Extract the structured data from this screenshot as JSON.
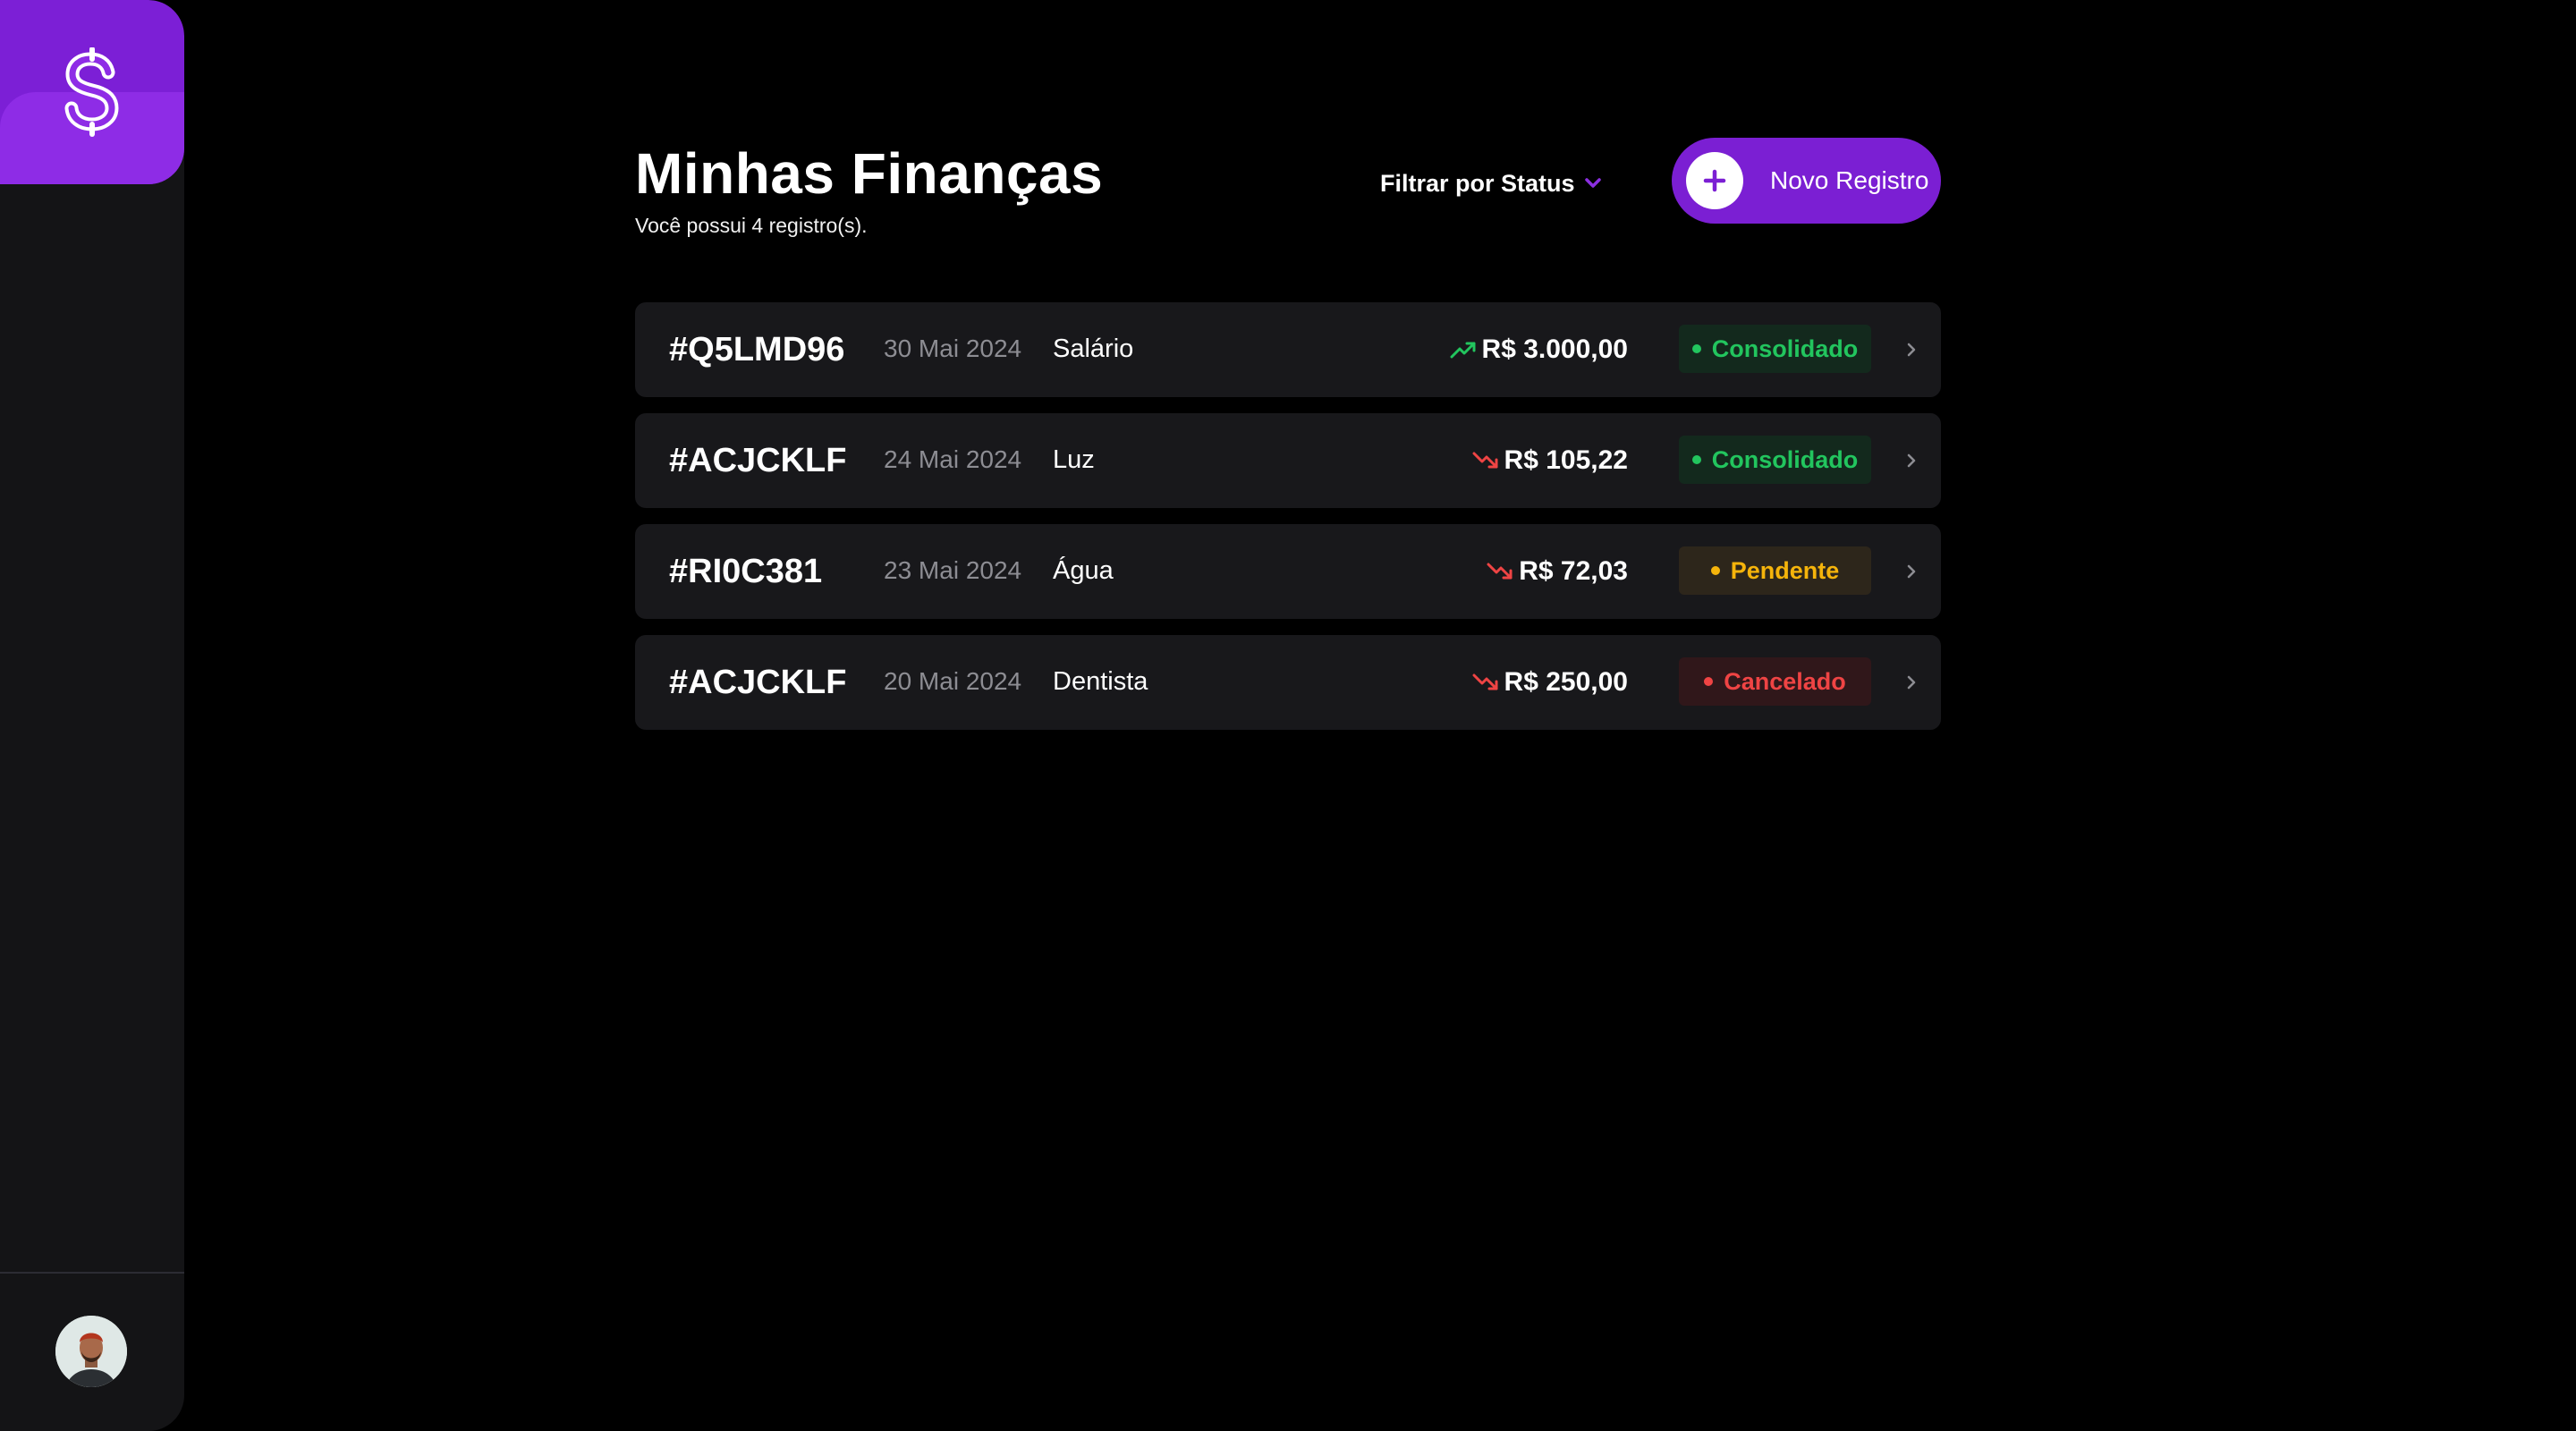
{
  "app": {
    "logo_icon": "dollar-sign-icon",
    "brand_color": "#7c1fd6"
  },
  "header": {
    "title": "Minhas Finanças",
    "subtitle": "Você possui 4 registro(s).",
    "filter_label": "Filtrar por Status",
    "filter_icon": "chevron-down-icon",
    "new_button_label": "Novo Registro",
    "new_button_icon": "plus-icon"
  },
  "records": [
    {
      "id": "#Q5LMD96",
      "date": "30 Mai 2024",
      "description": "Salário",
      "trend": "up",
      "trend_icon": "trending-up-icon",
      "amount": "R$ 3.000,00",
      "status": "Consolidado",
      "status_color": "#22c55e",
      "status_bg": "#13291d"
    },
    {
      "id": "#ACJCKLF",
      "date": "24 Mai 2024",
      "description": "Luz",
      "trend": "down",
      "trend_icon": "trending-down-icon",
      "amount": "R$ 105,22",
      "status": "Consolidado",
      "status_color": "#22c55e",
      "status_bg": "#13291d"
    },
    {
      "id": "#RI0C381",
      "date": "23 Mai 2024",
      "description": "Água",
      "trend": "down",
      "trend_icon": "trending-down-icon",
      "amount": "R$ 72,03",
      "status": "Pendente",
      "status_color": "#f5b40b",
      "status_bg": "#2d261b"
    },
    {
      "id": "#ACJCKLF",
      "date": "20 Mai 2024",
      "description": "Dentista",
      "trend": "down",
      "trend_icon": "trending-down-icon",
      "amount": "R$ 250,00",
      "status": "Cancelado",
      "status_color": "#ef4444",
      "status_bg": "#30171a"
    }
  ],
  "colors": {
    "trend_up": "#22c55e",
    "trend_down": "#ef4444",
    "accent": "#7b1fd3"
  }
}
